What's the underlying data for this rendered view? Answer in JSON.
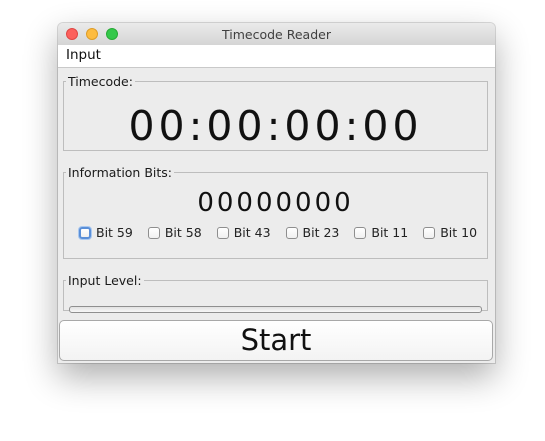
{
  "window": {
    "title": "Timecode Reader"
  },
  "menubar": {
    "items": [
      {
        "label": "Input"
      }
    ]
  },
  "timecode": {
    "label": "Timecode:",
    "value": "00:00:00:00"
  },
  "info_bits": {
    "label": "Information Bits:",
    "value": "00000000",
    "checkboxes": [
      {
        "label": "Bit 59",
        "checked": false,
        "focused": true
      },
      {
        "label": "Bit 58",
        "checked": false
      },
      {
        "label": "Bit 43",
        "checked": false
      },
      {
        "label": "Bit 23",
        "checked": false
      },
      {
        "label": "Bit 11",
        "checked": false
      },
      {
        "label": "Bit 10",
        "checked": false
      }
    ]
  },
  "input_level": {
    "label": "Input Level:",
    "level": 0
  },
  "actions": {
    "start_label": "Start"
  },
  "colors": {
    "close": "#fc605c",
    "minimize": "#fdbc40",
    "maximize": "#34c84a",
    "focus_ring": "#5a8fd8"
  }
}
